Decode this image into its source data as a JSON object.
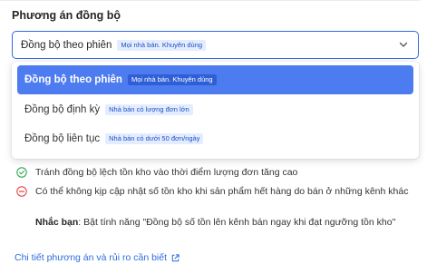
{
  "section": {
    "title": "Phương án đồng bộ"
  },
  "select": {
    "value": "Đồng bộ theo phiên",
    "badge": "Mọi nhà bán. Khuyên dùng"
  },
  "options": [
    {
      "label": "Đồng bộ theo phiên",
      "badge": "Mọi nhà bán. Khuyên dùng",
      "selected": true
    },
    {
      "label": "Đồng bộ định kỳ",
      "badge": "Nhà bán có lượng đơn lớn",
      "selected": false
    },
    {
      "label": "Đồng bộ liên tục",
      "badge": "Nhà bán có dưới 50 đơn/ngày",
      "selected": false
    }
  ],
  "details": {
    "pro": "Tránh đồng bộ lệch tồn kho vào thời điểm lượng đơn tăng cao",
    "con": "Có thể không kịp cập nhật số tồn kho khi sản phẩm hết hàng do bán ở những kênh khác",
    "note_label": "Nhắc bạn",
    "note_text": ": Bật tính năng \"Đồng bộ số tồn lên kênh bán ngay khi đạt ngưỡng tồn kho\""
  },
  "link": {
    "label": "Chi tiết phương án và rủi ro cần biết"
  },
  "colors": {
    "accent": "#2d6cdf",
    "selected_bg": "#4d7cf0",
    "badge_bg": "#e3edff",
    "success": "#2fa84f",
    "danger": "#e5484d"
  },
  "icons": {
    "chevron": "chevron-down-icon",
    "pro": "check-circle-icon",
    "con": "minus-circle-icon",
    "link": "external-link-icon"
  }
}
